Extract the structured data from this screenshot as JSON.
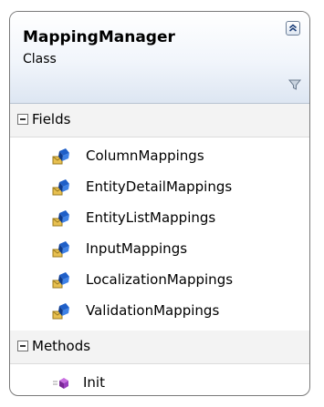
{
  "class": {
    "name": "MappingManager",
    "stereotype": "Class"
  },
  "icons": {
    "collapse": "chevron-double-up-icon",
    "filter": "filter-icon",
    "field": "field-icon",
    "method": "method-icon"
  },
  "fields": {
    "title": "Fields",
    "items": [
      {
        "label": "ColumnMappings"
      },
      {
        "label": "EntityDetailMappings"
      },
      {
        "label": "EntityListMappings"
      },
      {
        "label": "InputMappings"
      },
      {
        "label": "LocalizationMappings"
      },
      {
        "label": "ValidationMappings"
      }
    ]
  },
  "methods": {
    "title": "Methods",
    "items": [
      {
        "label": "Init"
      }
    ]
  },
  "colors": {
    "border": "#7a7a7a",
    "header_gradient_end": "#dde6f2",
    "field_icon_blue": "#1f5fc8",
    "field_icon_envelope": "#e8c050",
    "method_icon_purple": "#9b3fbf"
  }
}
